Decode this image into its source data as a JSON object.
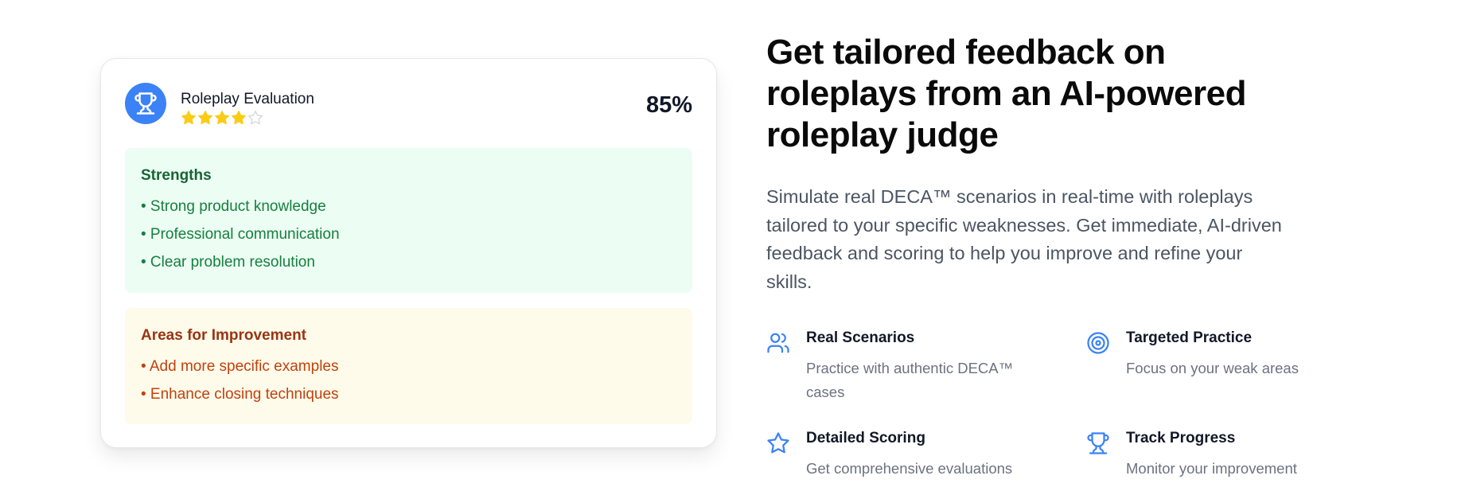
{
  "card": {
    "title": "Roleplay Evaluation",
    "score": "85%",
    "rating": {
      "value": 4,
      "max": 5
    },
    "strengths": {
      "title": "Strengths",
      "items": [
        "• Strong product knowledge",
        "• Professional communication",
        "• Clear problem resolution"
      ]
    },
    "improvement": {
      "title": "Areas for Improvement",
      "items": [
        "• Add more specific examples",
        "• Enhance closing techniques"
      ]
    }
  },
  "hero": {
    "headline": "Get tailored feedback on roleplays from an AI-powered roleplay judge",
    "description": "Simulate real DECA™ scenarios in real-time with roleplays tailored to your specific weaknesses. Get immediate, AI-driven feedback and scoring to help you improve and refine your skills."
  },
  "features": [
    {
      "icon": "users-icon",
      "title": "Real Scenarios",
      "description": "Practice with authentic DECA™ cases"
    },
    {
      "icon": "target-icon",
      "title": "Targeted Practice",
      "description": "Focus on your weak areas"
    },
    {
      "icon": "star-icon",
      "title": "Detailed Scoring",
      "description": "Get comprehensive evaluations"
    },
    {
      "icon": "trophy-icon",
      "title": "Track Progress",
      "description": "Monitor your improvement"
    }
  ],
  "colors": {
    "accent": "#3b82f6",
    "star_filled": "#facc15",
    "strengths_bg": "#ecfdf3",
    "improvement_bg": "#fffbeb"
  }
}
